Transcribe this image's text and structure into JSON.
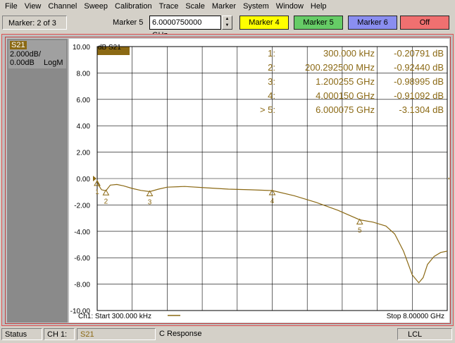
{
  "menu": [
    "File",
    "View",
    "Channel",
    "Sweep",
    "Calibration",
    "Trace",
    "Scale",
    "Marker",
    "System",
    "Window",
    "Help"
  ],
  "toolbar": {
    "marker_count": "Marker: 2 of 3",
    "marker_label": "Marker 5",
    "marker_value": "6.0000750000 GHz",
    "buttons": {
      "m4": "Marker 4",
      "m5": "Marker 5",
      "m6": "Marker 6",
      "off": "Off"
    }
  },
  "trace_panel": {
    "param": "S21",
    "scale": "2.000dB/",
    "ref": "0.00dB",
    "format": "LogM"
  },
  "colors": {
    "trace": "#8b6914",
    "m4": "#ffff00",
    "m5": "#66cc66",
    "m6": "#8a8ef0",
    "off": "#f07070",
    "grid": "#000000"
  },
  "chart_data": {
    "type": "line",
    "trace_label": "dB S21",
    "ylim": [
      -10,
      10
    ],
    "y_ticks": [
      "10.00",
      "8.00",
      "6.00",
      "4.00",
      "2.00",
      "0.00",
      "-2.00",
      "-4.00",
      "-6.00",
      "-8.00",
      "-10.00"
    ],
    "xlim_ghz": [
      0.0003,
      8.0
    ],
    "start_label": "Ch1: Start  300.000 kHz",
    "stop_label": "Stop  8.00000 GHz",
    "series": [
      {
        "x": [
          0.0003,
          0.05,
          0.1,
          0.2003,
          0.3,
          0.45,
          0.6,
          0.8,
          1.0,
          1.2003,
          1.4,
          1.6,
          2.0,
          2.5,
          3.0,
          3.5,
          4.0002,
          4.5,
          5.0,
          5.5,
          6.0001,
          6.3,
          6.6,
          6.8,
          7.0,
          7.2,
          7.35,
          7.45,
          7.55,
          7.7,
          7.85,
          8.0
        ],
        "values": [
          -0.21,
          -0.6,
          -0.85,
          -0.92,
          -0.5,
          -0.45,
          -0.55,
          -0.75,
          -0.9,
          -0.99,
          -0.8,
          -0.65,
          -0.6,
          -0.7,
          -0.8,
          -0.85,
          -0.91,
          -1.3,
          -1.8,
          -2.4,
          -3.13,
          -3.3,
          -3.6,
          -4.2,
          -5.5,
          -7.3,
          -7.9,
          -7.5,
          -6.5,
          -5.9,
          -5.6,
          -5.5
        ]
      }
    ],
    "markers": [
      {
        "label": "1:",
        "freq": "300.000 kHz",
        "value": "-0.20791 dB",
        "x": 0.0003,
        "y": -0.2079,
        "num": "1",
        "active": false
      },
      {
        "label": "2:",
        "freq": "200.292500 MHz",
        "value": "-0.92440 dB",
        "x": 0.2003,
        "y": -0.9244,
        "num": "2",
        "active": false
      },
      {
        "label": "3:",
        "freq": "1.200255 GHz",
        "value": "-0.98995 dB",
        "x": 1.2003,
        "y": -0.99,
        "num": "3",
        "active": false
      },
      {
        "label": "4:",
        "freq": "4.000150 GHz",
        "value": "-0.91092 dB",
        "x": 4.0002,
        "y": -0.9109,
        "num": "4",
        "active": false
      },
      {
        "label": "> 5:",
        "freq": "6.000075 GHz",
        "value": "-3.1304 dB",
        "x": 6.0001,
        "y": -3.1304,
        "num": "5",
        "active": true
      }
    ]
  },
  "statusbar": {
    "status": "Status",
    "channel": "CH 1:",
    "trace": "S21",
    "response": "C  Response",
    "lcl": "LCL"
  }
}
